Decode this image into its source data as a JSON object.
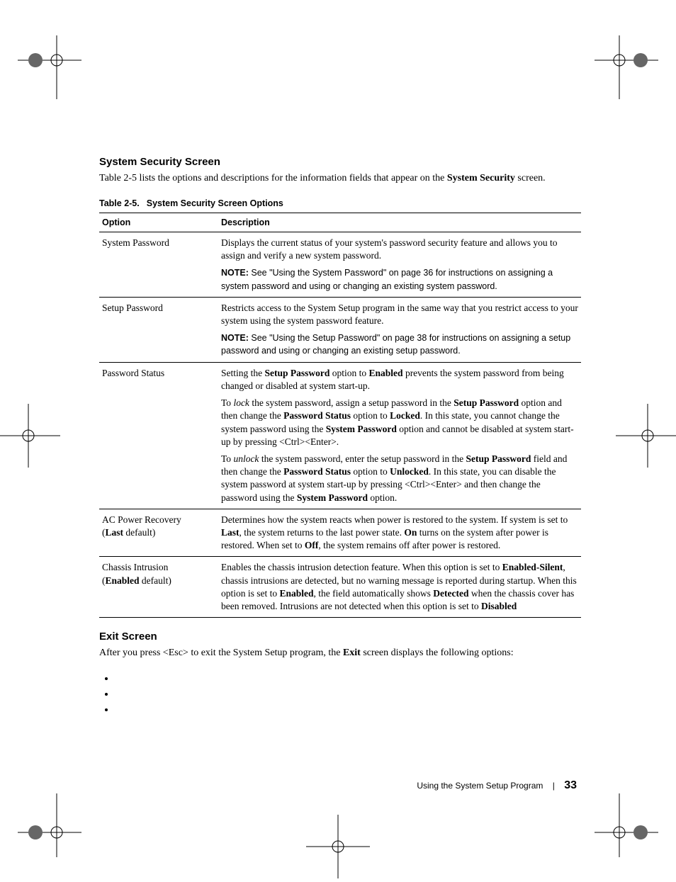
{
  "section1": {
    "heading": "System Security Screen",
    "intro_pre": "Table 2-5 lists the options and descriptions for the information fields that appear on the ",
    "intro_bold": "System Security",
    "intro_post": " screen."
  },
  "table": {
    "caption_label": "Table 2-5.",
    "caption_title": "System Security Screen Options",
    "col_option": "Option",
    "col_desc": "Description"
  },
  "rows": {
    "r1_opt": "System Password",
    "r1_p1": "Displays the current status of your system's password security feature and allows you to assign and verify a new system password.",
    "r1_note_label": "NOTE: ",
    "r1_note_text": "See \"Using the System Password\" on page 36 for instructions on assigning a system password and using or changing an existing system password.",
    "r2_opt": "Setup Password",
    "r2_p1": "Restricts access to the System Setup program in the same way that you restrict access to your system using the system password feature.",
    "r2_note_label": "NOTE: ",
    "r2_note_text": "See \"Using the Setup Password\" on page 38 for instructions on assigning a setup password and using or changing an existing setup password.",
    "r3_opt": "Password Status",
    "r3_p1a": "Setting the ",
    "r3_p1b": "Setup Password",
    "r3_p1c": " option to ",
    "r3_p1d": "Enabled",
    "r3_p1e": " prevents the system password from being changed or disabled at system start-up.",
    "r3_p2a": "To ",
    "r3_p2b": "lock",
    "r3_p2c": " the system password, assign a setup password in the ",
    "r3_p2d": "Setup Password",
    "r3_p2e": " option and then change the ",
    "r3_p2f": "Password Status",
    "r3_p2g": " option to ",
    "r3_p2h": "Locked",
    "r3_p2i": ". In this state, you cannot change the system password using the ",
    "r3_p2j": "System Password",
    "r3_p2k": " option and cannot be disabled at system start-up by pressing <Ctrl><Enter>.",
    "r3_p3a": "To ",
    "r3_p3b": "unlock",
    "r3_p3c": " the system password, enter the setup password in the ",
    "r3_p3d": "Setup Password",
    "r3_p3e": " field and then change the ",
    "r3_p3f": "Password Status",
    "r3_p3g": " option to ",
    "r3_p3h": "Unlocked",
    "r3_p3i": ". In this state, you can disable the system password at system start-up by pressing <Ctrl><Enter> and then change the password using the ",
    "r3_p3j": "System Password",
    "r3_p3k": " option.",
    "r4_opt1": "AC Power Recovery",
    "r4_opt2a": "(",
    "r4_opt2b": "Last",
    "r4_opt2c": " default)",
    "r4_p1a": "Determines how the system reacts when power is restored to the system. If system is set to ",
    "r4_p1b": "Last",
    "r4_p1c": ", the system returns to the last power state. ",
    "r4_p1d": "On",
    "r4_p1e": " turns on the system after power is restored. When set to ",
    "r4_p1f": "Off",
    "r4_p1g": ", the system remains off after power is restored.",
    "r5_opt1": "Chassis Intrusion",
    "r5_opt2a": "(",
    "r5_opt2b": "Enabled",
    "r5_opt2c": " default)",
    "r5_p1a": "Enables the chassis intrusion detection feature. When this option is set to ",
    "r5_p1b": "Enabled-Silent",
    "r5_p1c": ", chassis intrusions are detected, but no warning message is reported during startup. When this option is set to ",
    "r5_p1d": "Enabled",
    "r5_p1e": ", the field automatically shows ",
    "r5_p1f": "Detected",
    "r5_p1g": " when the chassis cover has been removed. Intrusions are not detected when this option is set to ",
    "r5_p1h": "Disabled"
  },
  "section2": {
    "heading": "Exit Screen",
    "intro_a": "After you press <Esc> to exit the System Setup program, the ",
    "intro_b": "Exit",
    "intro_c": " screen displays the following options:"
  },
  "footer": {
    "text": "Using the System Setup Program",
    "page": "33"
  }
}
